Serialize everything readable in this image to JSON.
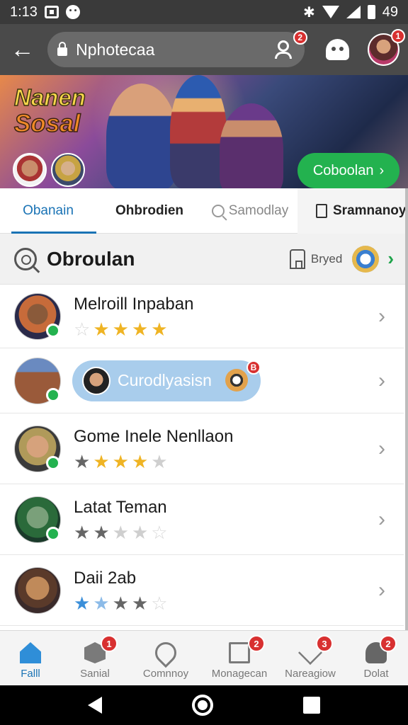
{
  "status_bar": {
    "time": "1:13",
    "battery": "49"
  },
  "app_bar": {
    "url": "Nphotecaa",
    "people_badge": "2",
    "avatar_badge": "1"
  },
  "hero": {
    "logo_line1": "Nanen",
    "logo_line2": "Sosal",
    "cta_label": "Coboolan",
    "cta_chevron": "›"
  },
  "tabs": [
    {
      "label": "Obanain",
      "active": true
    },
    {
      "label": "Ohbrodien",
      "active": false
    },
    {
      "label": "Samodlay",
      "active": false
    },
    {
      "label": "Sramnanoy",
      "active": false
    }
  ],
  "section": {
    "title": "Obroulan",
    "sort_label": "Bryed",
    "chevron": "›"
  },
  "list": [
    {
      "name": "Melroill Inpaban",
      "stars": [
        "empty",
        "gold",
        "gold",
        "gold",
        "gold"
      ]
    },
    {
      "pill_text": "Curodlyasisn",
      "badge": "B"
    },
    {
      "name": "Gome Inele Nenllaon",
      "stars": [
        "gray",
        "gold",
        "gold",
        "gold",
        "light"
      ]
    },
    {
      "name": "Latat Teman",
      "stars": [
        "gray",
        "gray",
        "light",
        "light",
        "empty"
      ]
    },
    {
      "name": "Daii 2ab",
      "stars": [
        "blue",
        "lightblue",
        "gray",
        "gray",
        "empty"
      ]
    }
  ],
  "star_glyph": "★",
  "row_chevron": "›",
  "bottom_nav": [
    {
      "label": "Falll",
      "icon": "home-icon",
      "badge": "",
      "active": true
    },
    {
      "label": "Sanial",
      "icon": "box-icon",
      "badge": "1"
    },
    {
      "label": "Comnnoy",
      "icon": "pin-icon",
      "badge": ""
    },
    {
      "label": "Monagecan",
      "icon": "mail-icon",
      "badge": "2"
    },
    {
      "label": "Nareagiow",
      "icon": "heart-icon",
      "badge": "3"
    },
    {
      "label": "Dolat",
      "icon": "person-icon",
      "badge": "2"
    }
  ],
  "colors": {
    "accent_blue": "#1a73b5",
    "cta_green": "#23b24f",
    "badge_red": "#d83030",
    "star_gold": "#efb424"
  }
}
